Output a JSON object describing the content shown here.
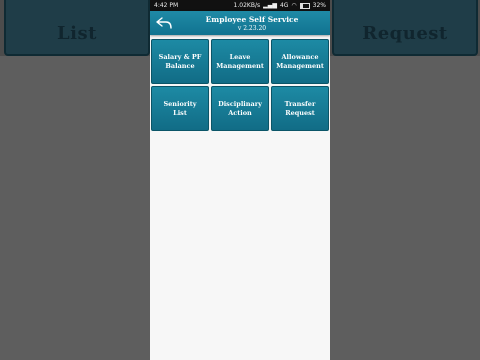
{
  "background": {
    "left_text": "List",
    "right_text": "Request"
  },
  "status_bar": {
    "time": "4:42 PM",
    "network_speed": "1.02KB/s",
    "network": "4G",
    "battery": "32%"
  },
  "header": {
    "title": "Employee Self Service",
    "version": "v 2.23.20",
    "back_icon": "back-arrow-icon"
  },
  "menu": {
    "tiles": [
      {
        "label": "Salary & PF\nBalance"
      },
      {
        "label": "Leave\nManagement"
      },
      {
        "label": "Allowance\nManagement"
      },
      {
        "label": "Seniority\nList"
      },
      {
        "label": "Disciplinary\nAction"
      },
      {
        "label": "Transfer\nRequest"
      }
    ]
  },
  "colors": {
    "accent": "#1a86a2",
    "screen_bg": "#f7f7f7"
  }
}
